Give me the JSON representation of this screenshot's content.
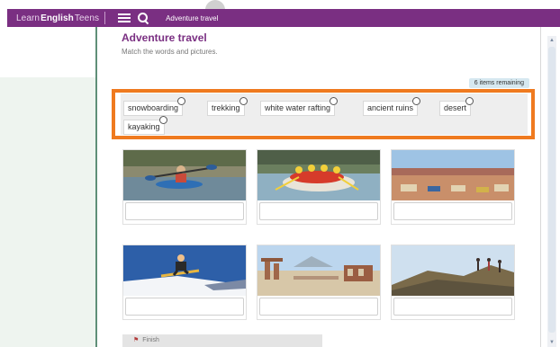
{
  "topbar": {
    "brand_part1": "Learn",
    "brand_part2": "English",
    "brand_part3": " Teens",
    "page_label": "Adventure travel",
    "bar_color": "#7a2f82"
  },
  "main": {
    "title": "Adventure travel",
    "instructions": "Match the words and pictures.",
    "remaining": "6 items remaining"
  },
  "words": [
    {
      "label": "snowboarding"
    },
    {
      "label": "trekking"
    },
    {
      "label": "white water rafting"
    },
    {
      "label": "ancient ruins"
    },
    {
      "label": "desert"
    },
    {
      "label": "kayaking"
    }
  ],
  "pictures": [
    {
      "name": "kayaking-photo"
    },
    {
      "name": "rafting-photo"
    },
    {
      "name": "desert-photo"
    },
    {
      "name": "snowboarding-photo"
    },
    {
      "name": "ruins-photo"
    },
    {
      "name": "trekking-photo"
    }
  ],
  "footer": {
    "finish_label": "Finish"
  },
  "colors": {
    "accent": "#7a2f82",
    "highlight_frame": "#ef7a1f",
    "badge_bg": "#d6e8f0"
  }
}
